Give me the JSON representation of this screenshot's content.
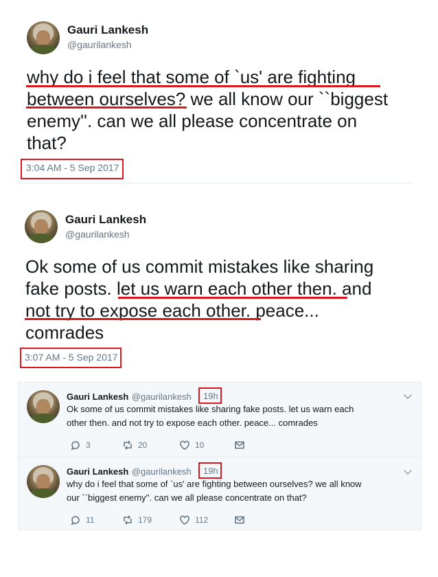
{
  "tweet1": {
    "name": "Gauri Lankesh",
    "handle": "@gaurilankesh",
    "lines": [
      "why do i feel that some of `us' are fighting",
      "between ourselves? we all know our ``biggest",
      "enemy''. can we all please concentrate on",
      "that?"
    ],
    "timestamp": "3:04 AM - 5 Sep 2017"
  },
  "tweet2": {
    "name": "Gauri Lankesh",
    "handle": "@gaurilankesh",
    "lines": [
      "Ok some of us commit mistakes like sharing",
      "fake posts. let us warn each other then. and",
      "not try to expose each other. peace...",
      "comrades"
    ],
    "timestamp": "3:07 AM - 5 Sep 2017"
  },
  "timeline": [
    {
      "name": "Gauri Lankesh",
      "handle": "@gaurilankesh",
      "dot": "·",
      "time": "19h",
      "lines": [
        "Ok some of us commit mistakes like sharing fake posts. let us warn each",
        "other then. and not try to expose each other. peace... comrades"
      ],
      "replies": "3",
      "retweets": "20",
      "likes": "10"
    },
    {
      "name": "Gauri Lankesh",
      "handle": "@gaurilankesh",
      "dot": "·",
      "time": "19h",
      "lines": [
        "why do i feel that some of `us' are fighting between ourselves? we all know",
        "our ``biggest enemy''. can we all please concentrate on that?"
      ],
      "replies": "11",
      "retweets": "179",
      "likes": "112"
    }
  ],
  "icons": [
    "reply-icon",
    "retweet-icon",
    "like-icon",
    "message-icon",
    "chevron-down-icon"
  ],
  "colors": {
    "highlight": "#d7191f",
    "text": "#14171a",
    "muted": "#657786",
    "card_bg": "#f5f8fa"
  }
}
